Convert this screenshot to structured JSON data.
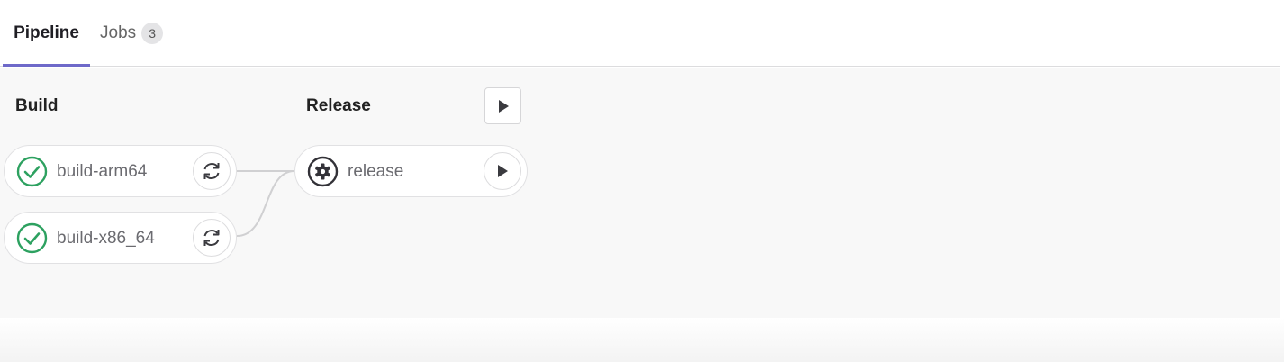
{
  "tabs": [
    {
      "label": "Pipeline",
      "active": true
    },
    {
      "label": "Jobs",
      "count": "3"
    }
  ],
  "stages": [
    {
      "name": "Build",
      "jobs": [
        {
          "name": "build-arm64",
          "status": "success",
          "status_icon": "check-circle-icon",
          "action_icon": "retry-icon"
        },
        {
          "name": "build-x86_64",
          "status": "success",
          "status_icon": "check-circle-icon",
          "action_icon": "retry-icon"
        }
      ]
    },
    {
      "name": "Release",
      "stage_action_icon": "play-icon",
      "jobs": [
        {
          "name": "release",
          "status": "manual",
          "status_icon": "gear-icon",
          "action_icon": "play-icon"
        }
      ]
    }
  ],
  "colors": {
    "active_tab_underline": "#6e69c9",
    "success": "#2da160",
    "manual": "#333238"
  }
}
